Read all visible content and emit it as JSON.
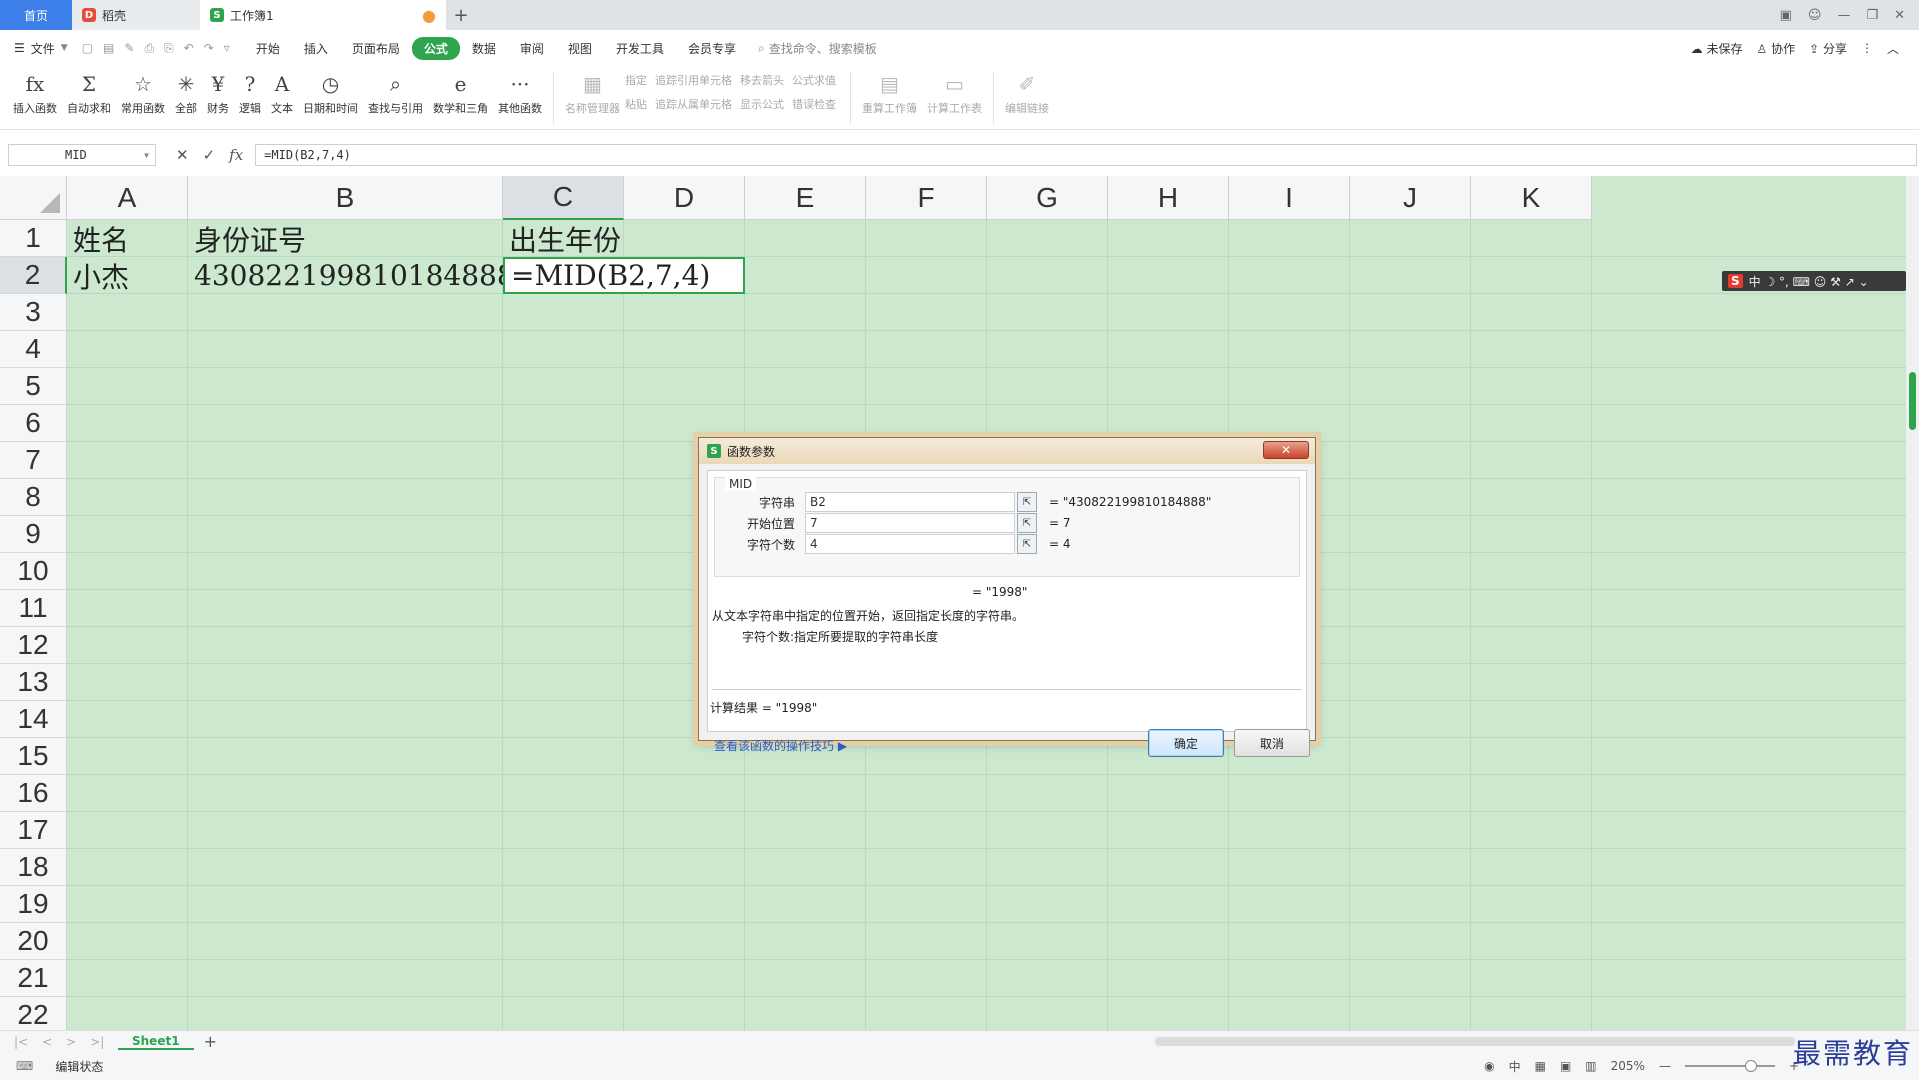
{
  "tabs": {
    "home": "首页",
    "shell": "稻壳",
    "book": "工作簿1"
  },
  "menu": {
    "file": "文件",
    "tabs": [
      "开始",
      "插入",
      "页面布局",
      "公式",
      "数据",
      "审阅",
      "视图",
      "开发工具",
      "会员专享"
    ],
    "active_tab": "公式",
    "search_placeholder": "查找命令、搜索模板",
    "unsaved": "未保存",
    "collab": "协作",
    "share": "分享"
  },
  "ribbon": {
    "buttons": [
      "插入函数",
      "自动求和",
      "常用函数",
      "全部",
      "财务",
      "逻辑",
      "文本",
      "日期和时间",
      "查找与引用",
      "数学和三角",
      "其他函数"
    ],
    "icons": [
      "fx",
      "Σ",
      "☆",
      "✳",
      "¥",
      "?",
      "A",
      "◷",
      "⌕",
      "e",
      "···"
    ],
    "name_manager": "名称管理器",
    "col1": [
      "指定",
      "粘贴"
    ],
    "col2": [
      "追踪引用单元格",
      "追踪从属单元格"
    ],
    "col3": [
      "移去箭头",
      "显示公式"
    ],
    "col4": [
      "公式求值",
      "错误检查"
    ],
    "recalc_book": "重算工作簿",
    "calc_sheet": "计算工作表",
    "edit_links": "编辑链接"
  },
  "formula_bar": {
    "name_box": "MID",
    "formula": "=MID(B2,7,4)"
  },
  "grid": {
    "columns": [
      "A",
      "B",
      "C",
      "D",
      "E",
      "F",
      "G",
      "H",
      "I",
      "J",
      "K"
    ],
    "selected_column": "C",
    "selected_row": 2,
    "row_count": 22,
    "cells": {
      "A1": "姓名",
      "B1": "身份证号",
      "C1": "出生年份",
      "A2": "小杰",
      "B2": "430822199810184888",
      "C2": "=MID(B2,7,4)"
    }
  },
  "ime_bar": {
    "logo": "S",
    "mode": "中 ☽ °, ⌨ ☺ ⚒ ↗ ⌄"
  },
  "dialog": {
    "title": "函数参数",
    "function_name": "MID",
    "args": [
      {
        "label": "字符串",
        "value": "B2",
        "result": "= \"430822199810184888\""
      },
      {
        "label": "开始位置",
        "value": "7",
        "result": "= 7"
      },
      {
        "label": "字符个数",
        "value": "4",
        "result": "= 4"
      }
    ],
    "func_result": "= \"1998\"",
    "description": "从文本字符串中指定的位置开始，返回指定长度的字符串。",
    "arg_help_label": "字符个数:",
    "arg_help_text": "指定所要提取的字符串长度",
    "calc_result": "计算结果 =  \"1998\"",
    "help_link": "查看该函数的操作技巧",
    "ok": "确定",
    "cancel": "取消"
  },
  "sheet_tab": "Sheet1",
  "status": {
    "mode": "编辑状态",
    "zoom": "205%"
  },
  "watermark": "最需教育"
}
